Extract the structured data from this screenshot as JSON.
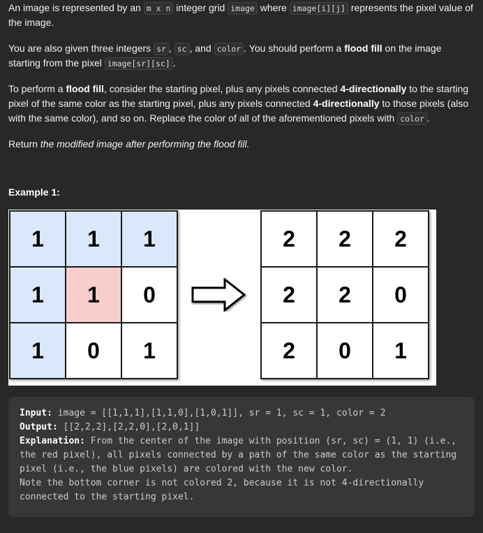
{
  "description": {
    "p1": {
      "t1": "An image is represented by an ",
      "c1": "m x n",
      "t2": " integer grid ",
      "c2": "image",
      "t3": " where ",
      "c3": "image[i][j]",
      "t4": " represents the pixel value of the image."
    },
    "p2": {
      "t1": "You are also given three integers ",
      "c1": "sr",
      "t2": ", ",
      "c2": "sc",
      "t3": ", and ",
      "c3": "color",
      "t4": ". You should perform a ",
      "b1": "flood fill",
      "t5": " on the image starting from the pixel ",
      "c4": "image[sr][sc]",
      "t6": "."
    },
    "p3": {
      "t1": "To perform a ",
      "b1": "flood fill",
      "t2": ", consider the starting pixel, plus any pixels connected ",
      "b2": "4-directionally",
      "t3": " to the starting pixel of the same color as the starting pixel, plus any pixels connected ",
      "b3": "4-directionally",
      "t4": " to those pixels (also with the same color), and so on. Replace the color of all of the aforementioned pixels with ",
      "c1": "color",
      "t5": "."
    },
    "p4": {
      "t1": "Return ",
      "i1": "the modified image after performing the flood fill."
    }
  },
  "example": {
    "title": "Example 1:",
    "figure": {
      "input_grid": [
        [
          {
            "v": "1",
            "fill": "blue"
          },
          {
            "v": "1",
            "fill": "blue"
          },
          {
            "v": "1",
            "fill": "blue"
          }
        ],
        [
          {
            "v": "1",
            "fill": "blue"
          },
          {
            "v": "1",
            "fill": "red"
          },
          {
            "v": "0",
            "fill": "white"
          }
        ],
        [
          {
            "v": "1",
            "fill": "blue"
          },
          {
            "v": "0",
            "fill": "white"
          },
          {
            "v": "1",
            "fill": "white"
          }
        ]
      ],
      "output_grid": [
        [
          "2",
          "2",
          "2"
        ],
        [
          "2",
          "2",
          "0"
        ],
        [
          "2",
          "0",
          "1"
        ]
      ],
      "colors": {
        "blue": "#dae8fc",
        "red": "#f8cecc",
        "white": "#ffffff"
      }
    },
    "input_label": "Input:",
    "input_value": " image = [[1,1,1],[1,1,0],[1,0,1]], sr = 1, sc = 1, color = 2",
    "output_label": "Output:",
    "output_value": " [[2,2,2],[2,2,0],[2,0,1]]",
    "explanation_label": "Explanation:",
    "explanation_value": " From the center of the image with position (sr, sc) = (1, 1) (i.e., the red pixel), all pixels connected by a path of the same color as the starting pixel (i.e., the blue pixels) are colored with the new color.\nNote the bottom corner is not colored 2, because it is not 4-directionally connected to the starting pixel."
  }
}
